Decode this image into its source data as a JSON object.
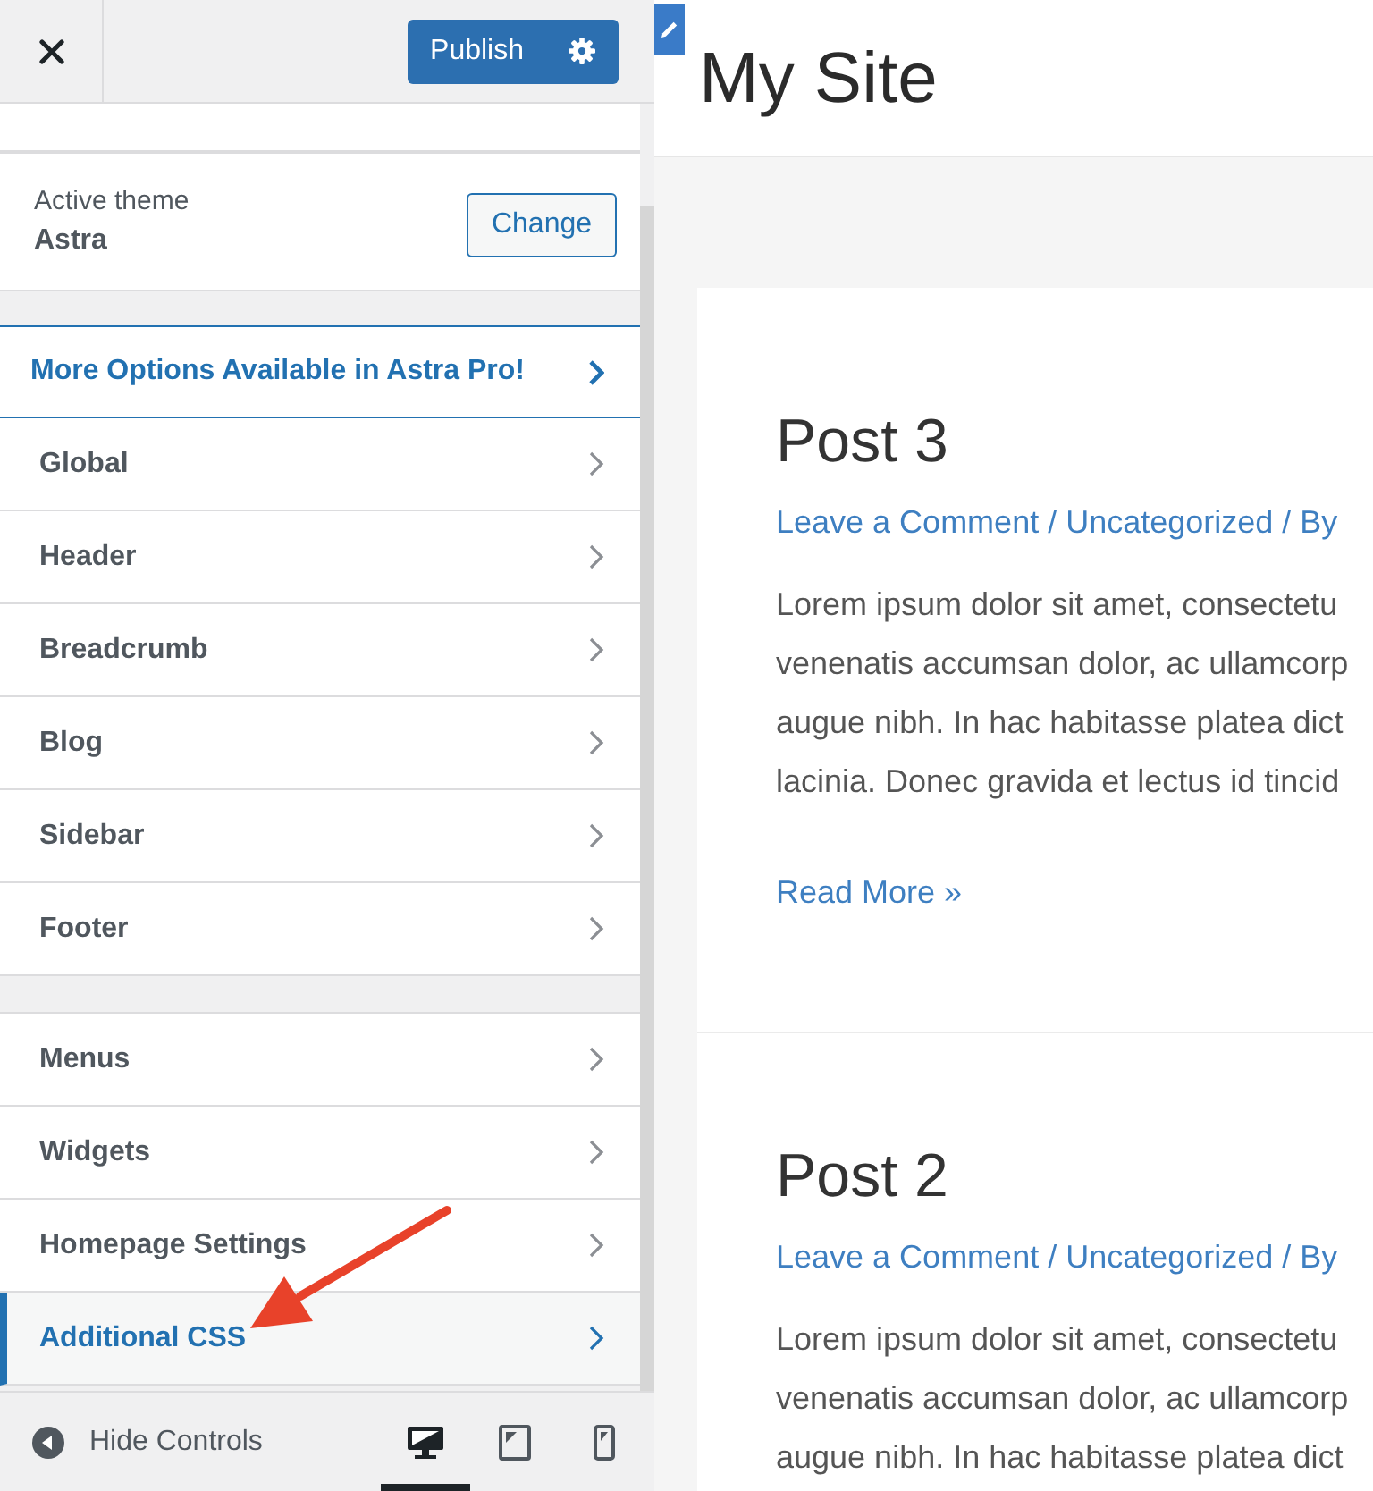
{
  "header": {
    "publish_button": "Publish"
  },
  "theme": {
    "label": "Active theme",
    "name": "Astra",
    "change_button": "Change"
  },
  "promo": {
    "label": "More Options Available in Astra Pro!"
  },
  "section_groups": [
    {
      "items": [
        {
          "label": "Global",
          "selected": false
        },
        {
          "label": "Header",
          "selected": false
        },
        {
          "label": "Breadcrumb",
          "selected": false
        },
        {
          "label": "Blog",
          "selected": false
        },
        {
          "label": "Sidebar",
          "selected": false
        },
        {
          "label": "Footer",
          "selected": false
        }
      ]
    },
    {
      "items": [
        {
          "label": "Menus",
          "selected": false
        },
        {
          "label": "Widgets",
          "selected": false
        },
        {
          "label": "Homepage Settings",
          "selected": false
        },
        {
          "label": "Additional CSS",
          "selected": true
        }
      ]
    }
  ],
  "footer": {
    "hide_controls": "Hide Controls",
    "devices": [
      {
        "kind": "desktop",
        "selected": true
      },
      {
        "kind": "tablet",
        "selected": false
      },
      {
        "kind": "mobile",
        "selected": false
      }
    ]
  },
  "preview": {
    "site_title": "My Site",
    "posts": [
      {
        "title": "Post 3",
        "meta": "Leave a Comment / Uncategorized / By",
        "excerpt_lines": [
          "Lorem ipsum dolor sit amet, consectetu",
          "venenatis accumsan dolor, ac ullamcorp",
          "augue nibh. In hac habitasse platea dict",
          "lacinia. Donec gravida et lectus id tincid"
        ],
        "read_more": "Read More »"
      },
      {
        "title": "Post 2",
        "meta": "Leave a Comment / Uncategorized / By",
        "excerpt_lines": [
          "Lorem ipsum dolor sit amet, consectetu",
          "venenatis accumsan dolor, ac ullamcorp",
          "augue nibh. In hac habitasse platea dict"
        ]
      }
    ]
  }
}
